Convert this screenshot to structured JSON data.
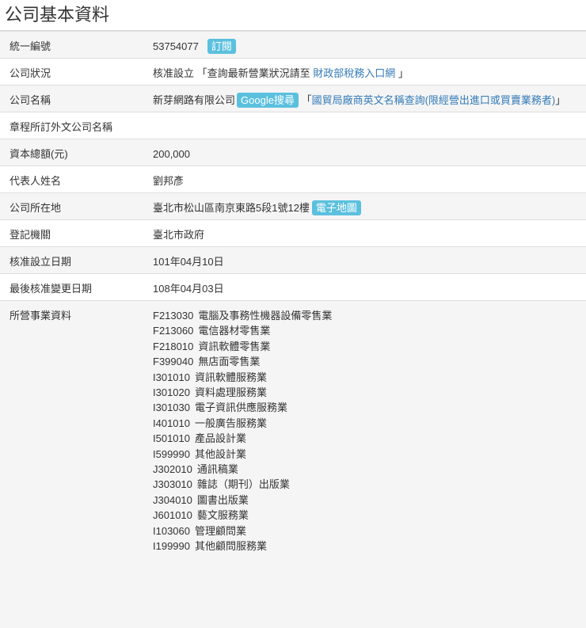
{
  "title": "公司基本資料",
  "rows": {
    "tax_id": {
      "label": "統一編號",
      "value": "53754077",
      "subscribe": "訂閱"
    },
    "status": {
      "label": "公司狀況",
      "value": "核准設立",
      "pre": "「查詢最新營業狀況請至",
      "link": "財政部稅務入口網",
      "post": "」"
    },
    "name": {
      "label": "公司名稱",
      "value": "新芽網路有限公司",
      "google": "Google搜尋",
      "pre": "「",
      "link": "國貿局廠商英文名稱查詢(限經營出進口或買賣業務者)",
      "post": "」"
    },
    "foreign_name": {
      "label": "章程所訂外文公司名稱",
      "value": ""
    },
    "capital": {
      "label": "資本總額(元)",
      "value": "200,000"
    },
    "representative": {
      "label": "代表人姓名",
      "value": "劉邦彥"
    },
    "address": {
      "label": "公司所在地",
      "value": "臺北市松山區南京東路5段1號12樓",
      "map": "電子地圖"
    },
    "authority": {
      "label": "登記機關",
      "value": "臺北市政府"
    },
    "approved_date": {
      "label": "核准設立日期",
      "value": "101年04月10日"
    },
    "changed_date": {
      "label": "最後核准變更日期",
      "value": "108年04月03日"
    },
    "business": {
      "label": "所營事業資料",
      "items": [
        {
          "code": "F213030",
          "name": "電腦及事務性機器設備零售業"
        },
        {
          "code": "F213060",
          "name": "電信器材零售業"
        },
        {
          "code": "F218010",
          "name": "資訊軟體零售業"
        },
        {
          "code": "F399040",
          "name": "無店面零售業"
        },
        {
          "code": "I301010",
          "name": "資訊軟體服務業"
        },
        {
          "code": "I301020",
          "name": "資料處理服務業"
        },
        {
          "code": "I301030",
          "name": "電子資訊供應服務業"
        },
        {
          "code": "I401010",
          "name": "一般廣告服務業"
        },
        {
          "code": "I501010",
          "name": "產品設計業"
        },
        {
          "code": "I599990",
          "name": "其他設計業"
        },
        {
          "code": "J302010",
          "name": "通訊稿業"
        },
        {
          "code": "J303010",
          "name": "雜誌（期刊）出版業"
        },
        {
          "code": "J304010",
          "name": "圖書出版業"
        },
        {
          "code": "J601010",
          "name": "藝文服務業"
        },
        {
          "code": "I103060",
          "name": "管理顧問業"
        },
        {
          "code": "I199990",
          "name": "其他顧問服務業"
        }
      ]
    }
  }
}
